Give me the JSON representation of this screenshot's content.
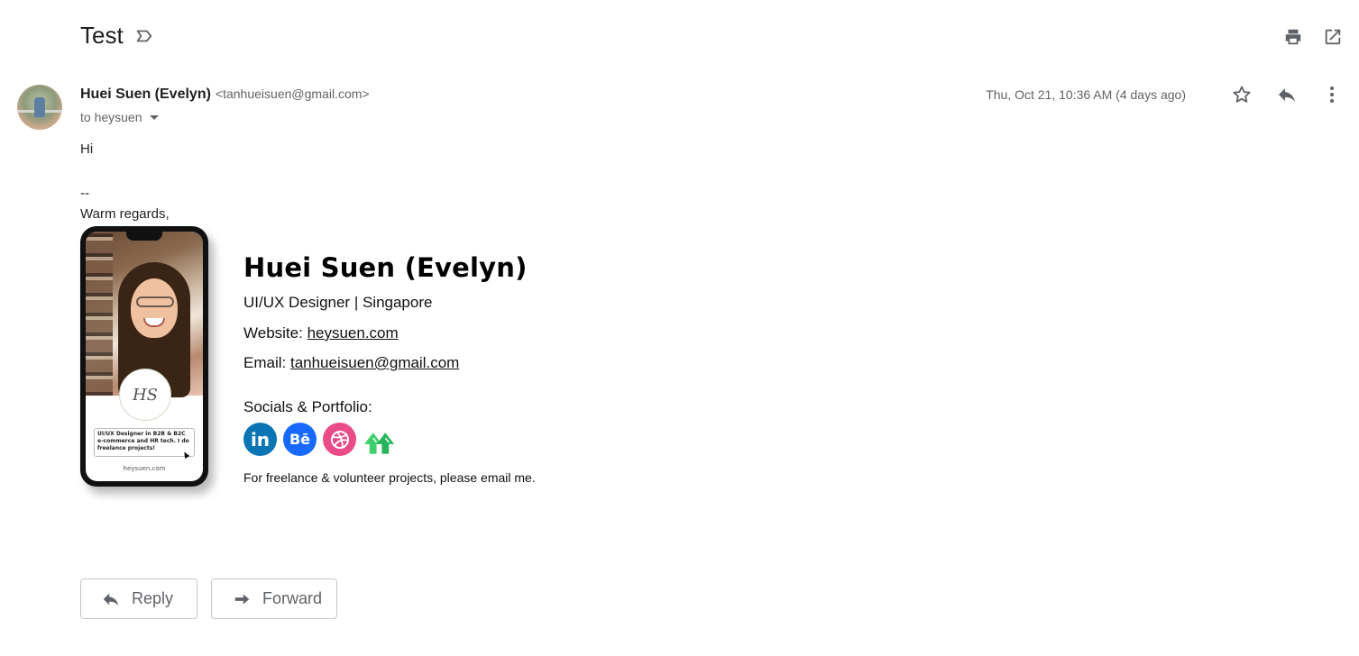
{
  "email": {
    "subject": "Test",
    "sender_name": "Huei Suen (Evelyn)",
    "sender_email": "<tanhueisuen@gmail.com>",
    "to": "to heysuen",
    "date": "Thu, Oct 21, 10:36 AM (4 days ago)",
    "body_greeting": "Hi",
    "body_dashes": "--",
    "body_regards": "Warm regards,"
  },
  "signature": {
    "name": "Huei Suen (Evelyn)",
    "role": "UI/UX Designer | Singapore",
    "website_label": "Website: ",
    "website": "heysuen.com",
    "email_label": "Email: ",
    "email": "tanhueisuen@gmail.com",
    "socials_label": "Socials & Portfolio:",
    "socials": [
      {
        "name": "LinkedIn",
        "icon": "linkedin-icon",
        "glyph": "in",
        "color": "#0a75b4"
      },
      {
        "name": "Behance",
        "icon": "behance-icon",
        "glyph": "Bē",
        "color": "#1769ff"
      },
      {
        "name": "Dribbble",
        "icon": "dribbble-icon",
        "color": "#ea4c89"
      },
      {
        "name": "Upwork",
        "icon": "upwork-icon",
        "color": "#3ccf6b"
      }
    ],
    "note": "For freelance & volunteer projects, please email me.",
    "phone": {
      "logo_text": "HS",
      "bio": "UI/UX Designer in B2B & B2C e-commerce and HR tech. I do freelance projects!",
      "url": "heysuen.com"
    }
  },
  "actions": {
    "reply": "Reply",
    "forward": "Forward"
  },
  "icons": {
    "label": "label-icon",
    "print": "print-icon",
    "new_window": "open-in-new-icon",
    "star": "star-icon",
    "reply": "reply-icon",
    "more": "more-vert-icon"
  }
}
